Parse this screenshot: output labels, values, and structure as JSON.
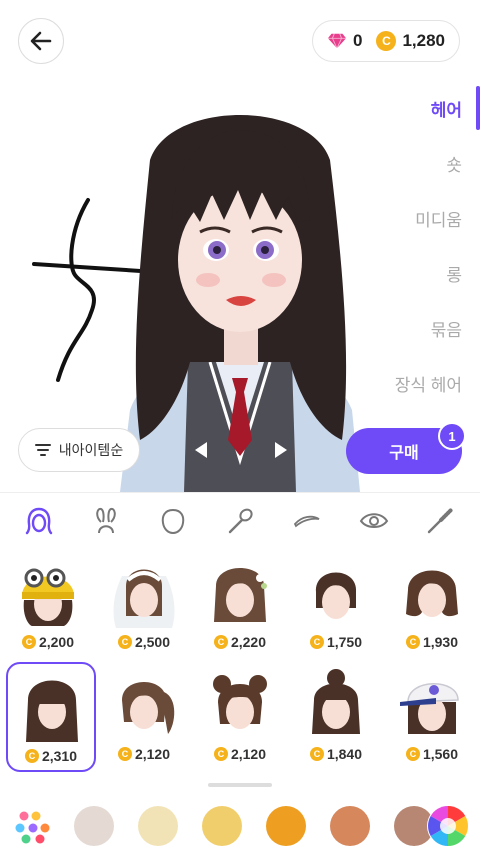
{
  "header": {
    "back_icon": "arrow-left-icon",
    "gem_icon": "gem-icon",
    "gem_count": "0",
    "coin_icon": "coin-icon",
    "coin_symbol": "C",
    "coin_count": "1,280"
  },
  "categories": [
    {
      "label": "헤어",
      "active": true
    },
    {
      "label": "숏"
    },
    {
      "label": "미디움"
    },
    {
      "label": "롱"
    },
    {
      "label": "묶음"
    },
    {
      "label": "장식 헤어"
    }
  ],
  "sort_label": "내아이템순",
  "buy": {
    "label": "구매",
    "badge": "1"
  },
  "feature_tabs": [
    "hair-icon",
    "ears-icon",
    "face-shape-icon",
    "makeup-brush-icon",
    "eyebrow-icon",
    "eye-icon",
    "mascara-icon"
  ],
  "items": [
    {
      "price": "2,200",
      "style": "yellow-beanie-hair"
    },
    {
      "price": "2,500",
      "style": "bridal-veil-hair"
    },
    {
      "price": "2,220",
      "style": "flower-hairpin-hair"
    },
    {
      "price": "1,750",
      "style": "short-hair"
    },
    {
      "price": "1,930",
      "style": "bob-hair"
    },
    {
      "price": "2,310",
      "style": "long-straight-hair",
      "selected": true
    },
    {
      "price": "2,120",
      "style": "side-ponytail-hair"
    },
    {
      "price": "2,120",
      "style": "double-buns-hair"
    },
    {
      "price": "1,840",
      "style": "top-bun-hair"
    },
    {
      "price": "1,560",
      "style": "white-cap-hair"
    }
  ],
  "colors": {
    "palette_icon": "palette-icon",
    "swatches": [
      "#e4d9d3",
      "#f2e3b7",
      "#f1ce6c",
      "#ee9f22",
      "#d6875b",
      "#b78773"
    ],
    "custom_icon": "color-wheel-icon"
  },
  "accent": "#6f4af7"
}
